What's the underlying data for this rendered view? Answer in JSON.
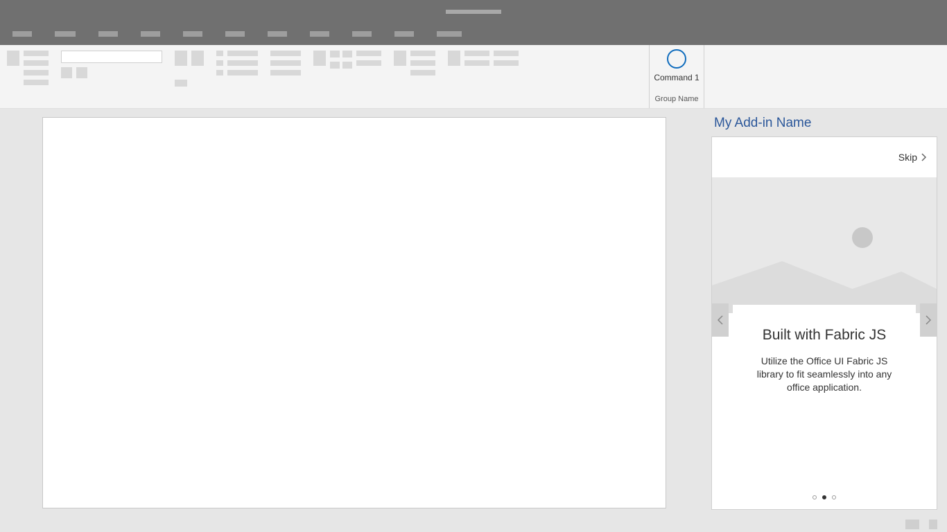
{
  "ribbon": {
    "command_label": "Command 1",
    "group_label": "Group Name"
  },
  "taskpane": {
    "title": "My Add-in Name",
    "skip_label": "Skip",
    "card": {
      "title": "Built with Fabric JS",
      "description": "Utilize the Office UI Fabric JS library to fit seamlessly into any office application."
    },
    "dots_active_index": 1,
    "dots_count": 3
  }
}
